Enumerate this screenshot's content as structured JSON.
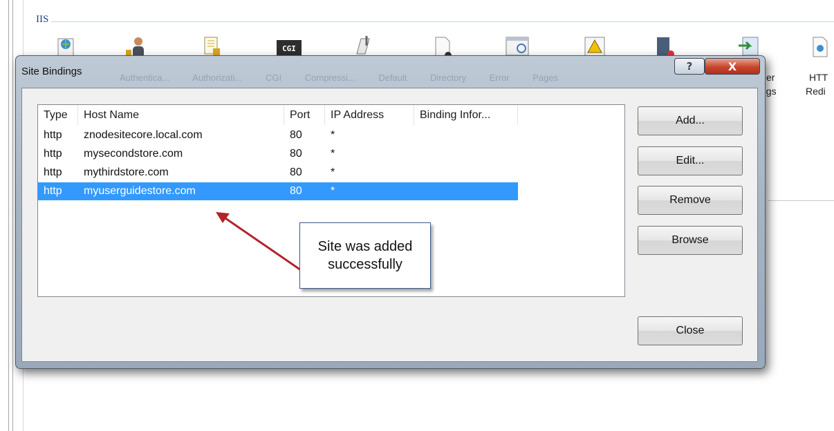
{
  "background": {
    "group_title": "IIS",
    "partial_labels": [
      "er",
      "ngs",
      "HTT",
      "Redi"
    ],
    "icons": [
      "asp-icon",
      "authentication-icon",
      "authorization-icon",
      "cgi-icon",
      "compression-icon",
      "default-document-icon",
      "directory-browsing-icon",
      "error-pages-icon",
      "failed-request-icon",
      "handler-mappings-icon",
      "http-redirect-icon"
    ],
    "cgi_label": "CGI",
    "ghost_labels": "Authentica... Authorizati... CGI Compressi... Default Directory Error Pages"
  },
  "dialog": {
    "title": "Site Bindings",
    "help_label": "?",
    "close_label": "X",
    "columns": [
      "Type",
      "Host Name",
      "Port",
      "IP Address",
      "Binding Infor..."
    ],
    "rows": [
      {
        "type": "http",
        "host": "znodesitecore.local.com",
        "port": "80",
        "ip": "*",
        "info": ""
      },
      {
        "type": "http",
        "host": "mysecondstore.com",
        "port": "80",
        "ip": "*",
        "info": ""
      },
      {
        "type": "http",
        "host": "mythirdstore.com",
        "port": "80",
        "ip": "*",
        "info": ""
      },
      {
        "type": "http",
        "host": "myuserguidestore.com",
        "port": "80",
        "ip": "*",
        "info": "",
        "selected": true
      }
    ],
    "buttons": {
      "add": "Add...",
      "edit": "Edit...",
      "remove": "Remove",
      "browse": "Browse",
      "close": "Close"
    }
  },
  "callout": {
    "line1": "Site was added",
    "line2": "successfully"
  },
  "colors": {
    "selection": "#3399ff",
    "arrow": "#b3232b",
    "close_button": "#c6452c"
  }
}
